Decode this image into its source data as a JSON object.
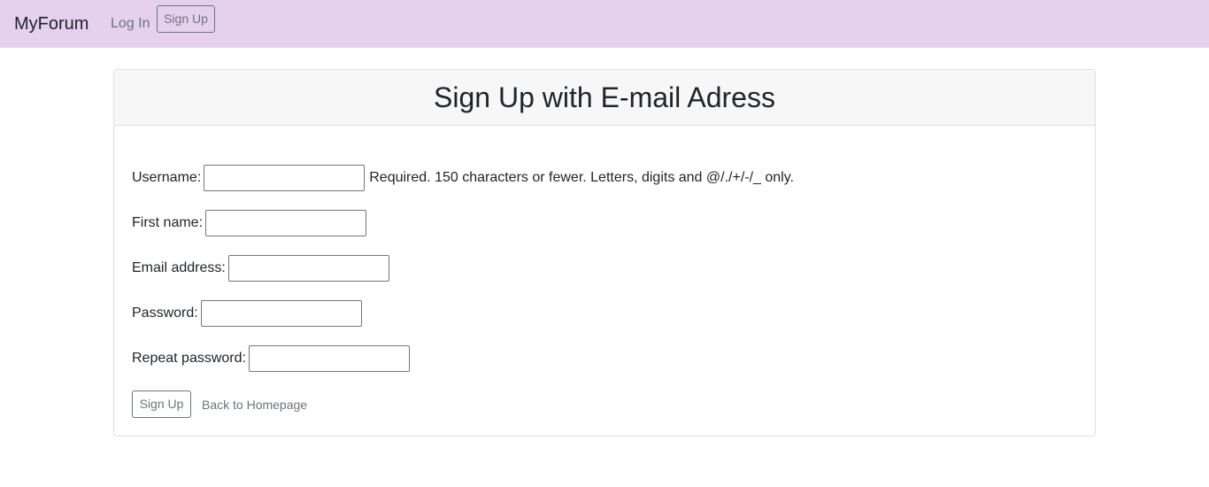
{
  "navbar": {
    "brand": "MyForum",
    "login": "Log In",
    "signup": "Sign Up"
  },
  "card": {
    "title": "Sign Up with E-mail Adress"
  },
  "form": {
    "username_label": "Username:",
    "username_value": "",
    "username_help": "Required. 150 characters or fewer. Letters, digits and @/./+/-/_ only.",
    "first_name_label": "First name:",
    "first_name_value": "",
    "email_label": "Email address:",
    "email_value": "",
    "password_label": "Password:",
    "password_value": "",
    "repeat_password_label": "Repeat password:",
    "repeat_password_value": "",
    "submit_label": "Sign Up",
    "back_link": "Back to Homepage"
  },
  "colors": {
    "navbar_bg": "#e5d0ef",
    "secondary": "#6c757d",
    "card_header_bg": "#f7f7f7"
  }
}
